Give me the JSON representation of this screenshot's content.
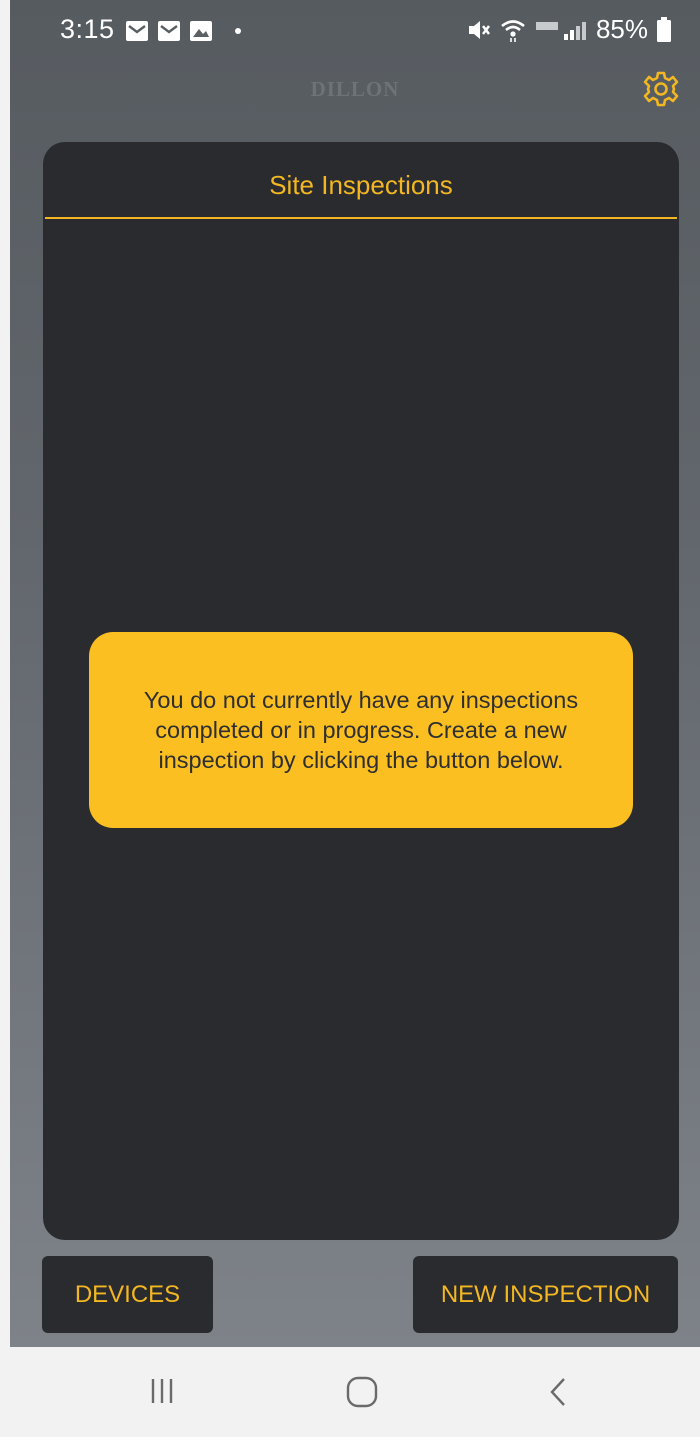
{
  "status_bar": {
    "time": "3:15",
    "battery": "85%"
  },
  "header": {
    "brand": "DILLON"
  },
  "card": {
    "title": "Site Inspections",
    "empty_message": "You do not currently have any inspections completed or in progress. Create a new inspection by clicking the button below."
  },
  "buttons": {
    "devices": "DEVICES",
    "new_inspection": "NEW INSPECTION"
  },
  "icons": {
    "settings": "gear-icon",
    "recents": "recents-icon",
    "home": "home-icon",
    "back": "back-icon"
  },
  "colors": {
    "accent": "#f2b722",
    "message_bg": "#fbbf22",
    "card_bg": "#2a2b2e"
  }
}
